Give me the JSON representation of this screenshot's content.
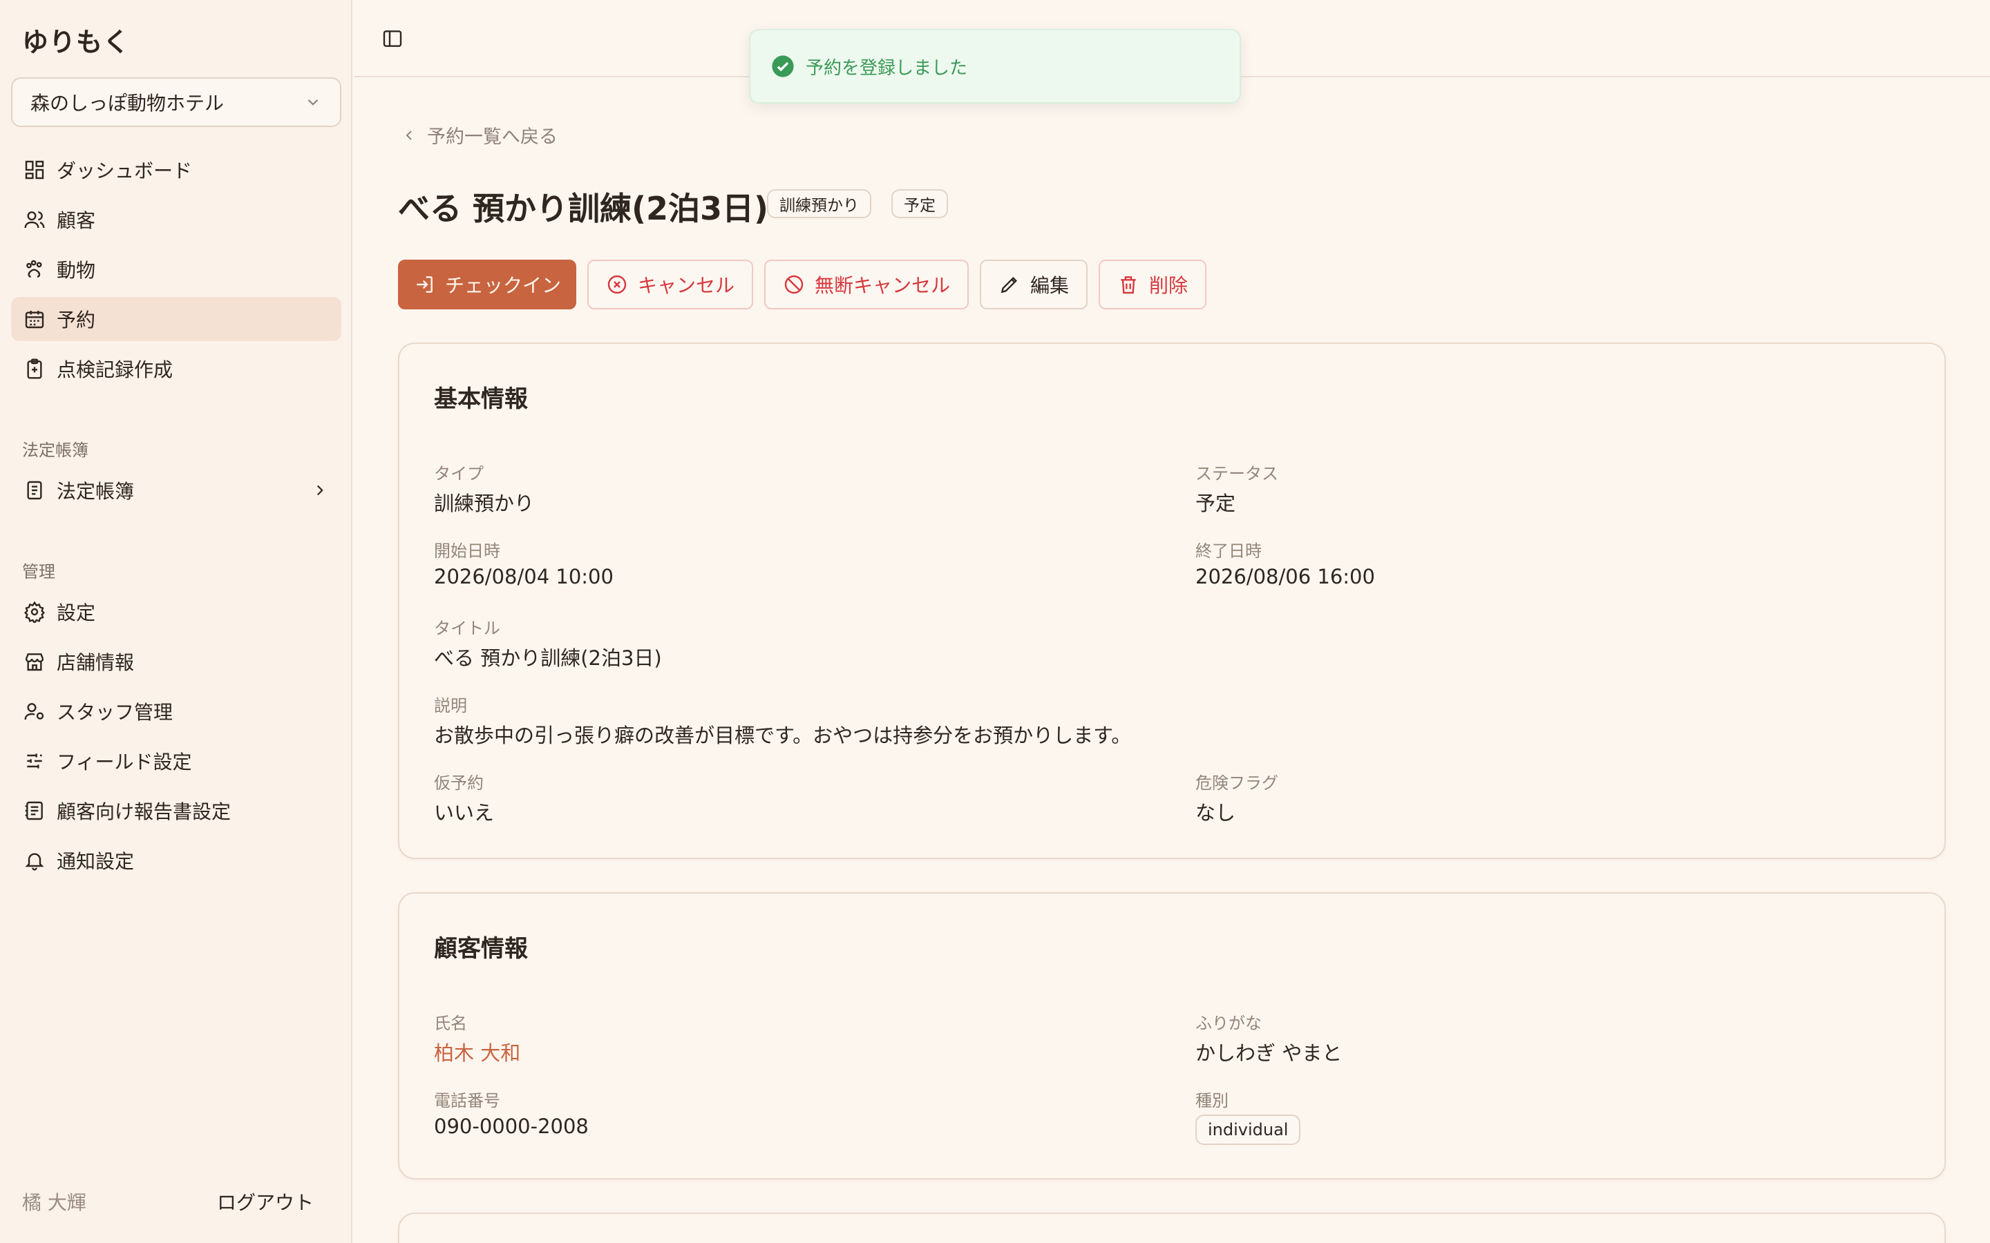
{
  "app": {
    "brand": "ゆりもく",
    "store": "森のしっぽ動物ホテル"
  },
  "sidebar": {
    "items": [
      {
        "label": "ダッシュボード",
        "icon": "dashboard-icon"
      },
      {
        "label": "顧客",
        "icon": "users-icon"
      },
      {
        "label": "動物",
        "icon": "paw-icon"
      },
      {
        "label": "予約",
        "icon": "calendar-icon",
        "active": true
      },
      {
        "label": "点検記録作成",
        "icon": "clipboard-plus-icon"
      }
    ],
    "section_legal": "法定帳簿",
    "legal_item": "法定帳簿",
    "section_admin": "管理",
    "admin_items": [
      {
        "label": "設定",
        "icon": "gear-icon"
      },
      {
        "label": "店舗情報",
        "icon": "store-icon"
      },
      {
        "label": "スタッフ管理",
        "icon": "user-cog-icon"
      },
      {
        "label": "フィールド設定",
        "icon": "sliders-icon"
      },
      {
        "label": "顧客向け報告書設定",
        "icon": "report-icon"
      },
      {
        "label": "通知設定",
        "icon": "bell-icon"
      }
    ],
    "user": "橘 大輝",
    "logout": "ログアウト"
  },
  "toast": {
    "message": "予約を登録しました",
    "color": "#3a9a57"
  },
  "page": {
    "back": "予約一覧へ戻る",
    "title": "べる 預かり訓練(2泊3日)",
    "badges": [
      "訓練預かり",
      "予定"
    ],
    "actions": {
      "checkin": "チェックイン",
      "cancel": "キャンセル",
      "no_show": "無断キャンセル",
      "edit": "編集",
      "delete": "削除"
    }
  },
  "basic": {
    "heading": "基本情報",
    "type_label": "タイプ",
    "type": "訓練預かり",
    "status_label": "ステータス",
    "status": "予定",
    "start_label": "開始日時",
    "start": "2026/08/04 10:00",
    "end_label": "終了日時",
    "end": "2026/08/06 16:00",
    "title_label": "タイトル",
    "title": "べる 預かり訓練(2泊3日)",
    "desc_label": "説明",
    "desc": "お散歩中の引っ張り癖の改善が目標です。おやつは持参分をお預かりします。",
    "tentative_label": "仮予約",
    "tentative": "いいえ",
    "danger_label": "危険フラグ",
    "danger": "なし"
  },
  "customer": {
    "heading": "顧客情報",
    "name_label": "氏名",
    "name": "柏木 大和",
    "kana_label": "ふりがな",
    "kana": "かしわぎ やまと",
    "phone_label": "電話番号",
    "phone": "090-0000-2008",
    "kind_label": "種別",
    "kind": "individual"
  },
  "colors": {
    "accent": "#c8643f",
    "danger": "#d6383e",
    "background": "#fdf6ef"
  }
}
